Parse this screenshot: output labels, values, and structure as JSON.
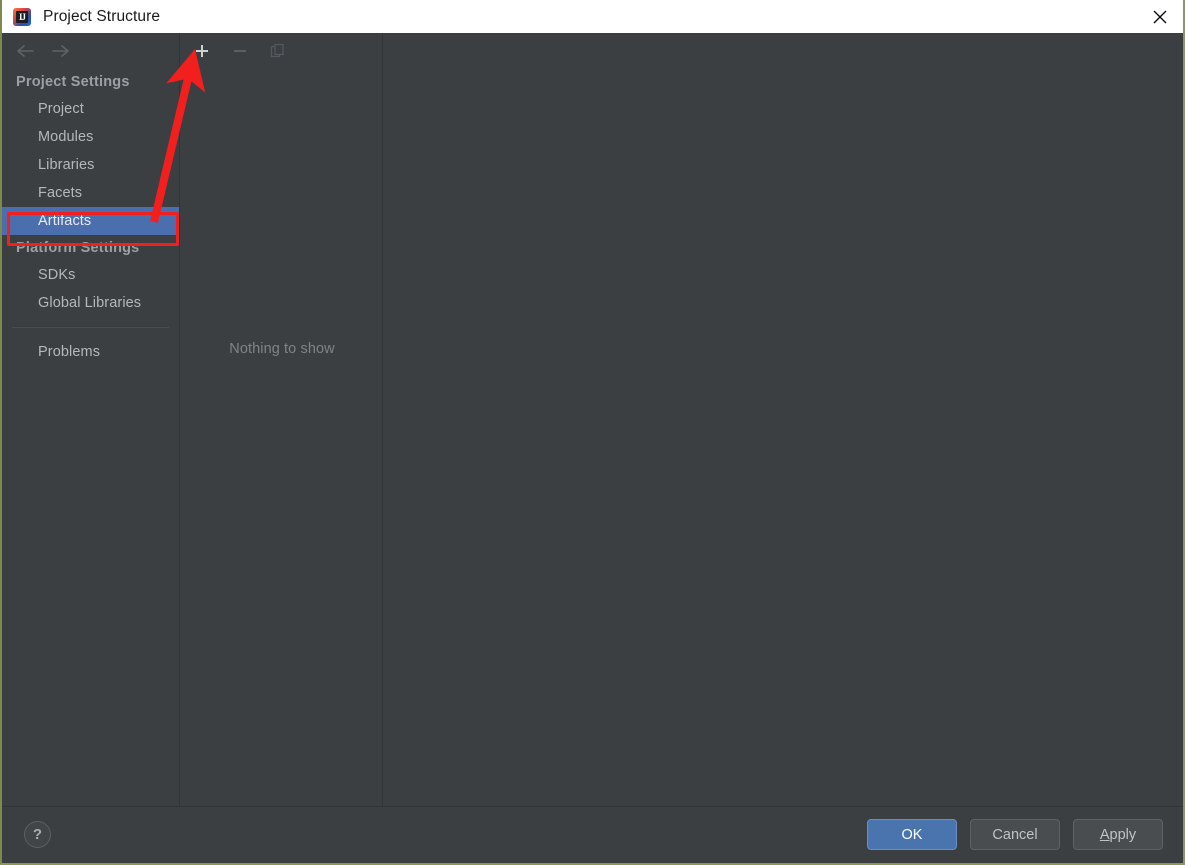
{
  "window": {
    "title": "Project Structure",
    "icon": "intellij-idea-icon",
    "icon_letters": "IJ",
    "close_icon": "close-icon",
    "accent_color": "#4b6eaf",
    "background_color": "#3c3f41",
    "annotation_color": "#f21f1f"
  },
  "nav": {
    "back_icon": "arrow-left-icon",
    "forward_icon": "arrow-right-icon"
  },
  "sidebar": {
    "groups": [
      {
        "label": "Project Settings",
        "items": [
          {
            "label": "Project",
            "selected": false
          },
          {
            "label": "Modules",
            "selected": false
          },
          {
            "label": "Libraries",
            "selected": false
          },
          {
            "label": "Facets",
            "selected": false
          },
          {
            "label": "Artifacts",
            "selected": true
          }
        ]
      },
      {
        "label": "Platform Settings",
        "items": [
          {
            "label": "SDKs",
            "selected": false
          },
          {
            "label": "Global Libraries",
            "selected": false
          }
        ]
      }
    ],
    "extra_items": [
      {
        "label": "Problems",
        "selected": false
      }
    ]
  },
  "toolbar": {
    "add": {
      "label": "+",
      "icon": "plus-icon",
      "enabled": true
    },
    "remove": {
      "label": "−",
      "icon": "minus-icon",
      "enabled": false
    },
    "copy": {
      "label": "Copy",
      "icon": "copy-icon",
      "enabled": false
    }
  },
  "middle_panel": {
    "empty_message": "Nothing to show"
  },
  "footer": {
    "help_label": "?",
    "help_icon": "question-mark-icon",
    "buttons": [
      {
        "label": "OK",
        "style": "primary",
        "mnemonic": ""
      },
      {
        "label": "Cancel",
        "style": "secondary",
        "mnemonic": ""
      },
      {
        "label": "Apply",
        "style": "secondary",
        "mnemonic": "A",
        "rest": "pply"
      }
    ]
  }
}
